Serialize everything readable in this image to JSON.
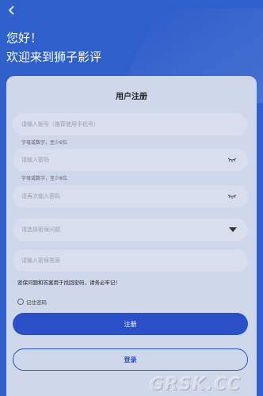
{
  "header": {
    "greeting": "您好！",
    "welcome": "欢迎来到狮子影评"
  },
  "form": {
    "title": "用户注册",
    "account_placeholder": "请输入账号（推荐使用手机号）",
    "account_hint": "字母或数字，至少6位",
    "password_placeholder": "请输入密码",
    "password_hint": "字母或数字，至少8位",
    "confirm_placeholder": "请再次输入密码",
    "question_placeholder": "请选择密保问题",
    "answer_placeholder": "请输入密保答案",
    "notice": "密保问题和答案用于找回密码，请务必牢记！",
    "remember_label": "记住密码",
    "register_label": "注册",
    "login_label": "登录"
  },
  "watermark": "GRSK.CC",
  "colors": {
    "background": "#2f5fcb",
    "card": "#cfd7ea",
    "primary": "#2a4fc6"
  }
}
